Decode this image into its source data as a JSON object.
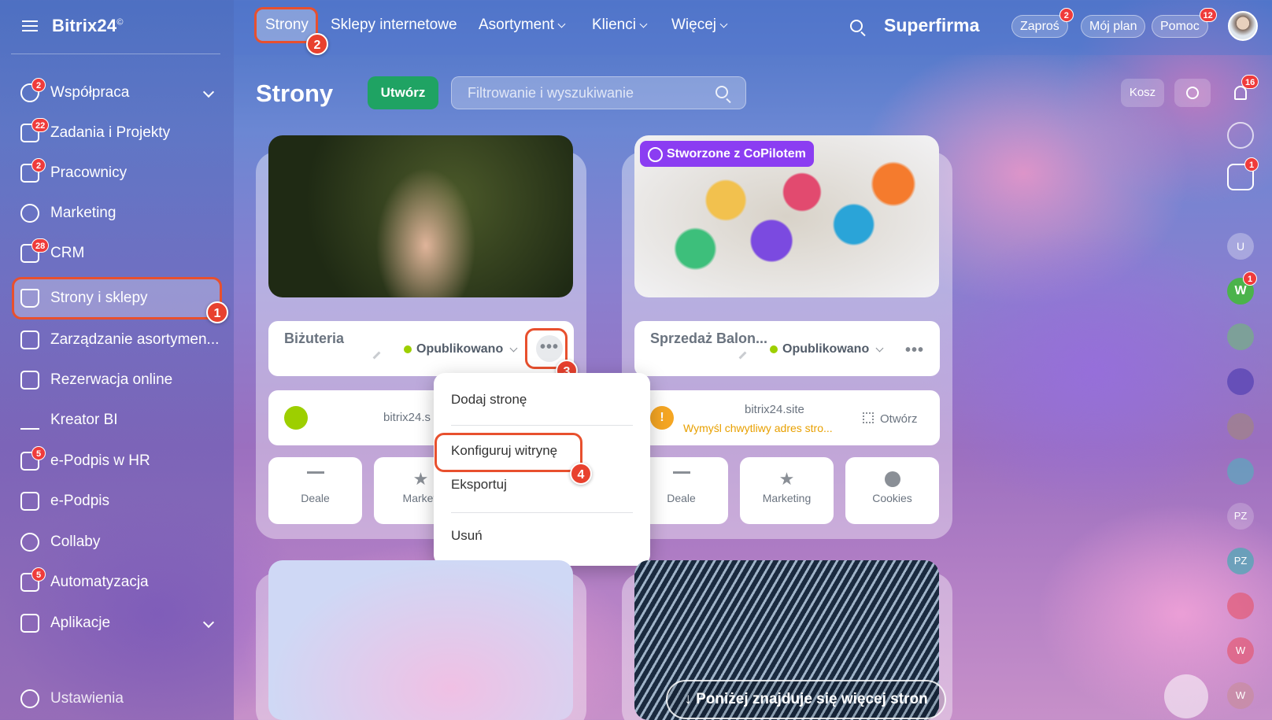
{
  "brand": {
    "name": "Bitrix24",
    "mark": "©"
  },
  "sidebar": {
    "items": [
      {
        "label": "Współpraca",
        "badge": "2"
      },
      {
        "label": "Zadania i Projekty",
        "badge": "22"
      },
      {
        "label": "Pracownicy",
        "badge": "2"
      },
      {
        "label": "Marketing",
        "badge": ""
      },
      {
        "label": "CRM",
        "badge": "28"
      },
      {
        "label": "Strony i sklepy",
        "badge": ""
      },
      {
        "label": "Zarządzanie asortymen...",
        "badge": ""
      },
      {
        "label": "Rezerwacja online",
        "badge": ""
      },
      {
        "label": "Kreator BI",
        "badge": ""
      },
      {
        "label": "e-Podpis w HR",
        "badge": "5"
      },
      {
        "label": "e-Podpis",
        "badge": ""
      },
      {
        "label": "Collaby",
        "badge": ""
      },
      {
        "label": "Automatyzacja",
        "badge": "5"
      },
      {
        "label": "Aplikacje",
        "badge": ""
      }
    ],
    "settings": "Ustawienia"
  },
  "topnav": {
    "items": [
      "Strony",
      "Sklepy internetowe",
      "Asortyment",
      "Klienci",
      "Więcej"
    ]
  },
  "header": {
    "company": "Superfirma",
    "invite": "Zaproś",
    "invite_badge": "2",
    "plan": "Mój plan",
    "help": "Pomoc",
    "help_badge": "12"
  },
  "page": {
    "title": "Strony",
    "create": "Utwórz",
    "search_placeholder": "Filtrowanie i wyszukiwanie",
    "trash": "Kosz",
    "notif_badge": "16"
  },
  "cards": [
    {
      "title": "Biżuteria",
      "status": "Opublikowano",
      "url": "bitrix24.s",
      "tiles": [
        "Deale",
        "Marketi"
      ]
    },
    {
      "title": "Sprzedaż Balon...",
      "status": "Opublikowano",
      "url": "bitrix24.site",
      "url_hint": "Wymyśl chwytliwy adres stro...",
      "open": "Otwórz",
      "tag": "Stworzone z CoPilotem",
      "tiles": [
        "Deale",
        "Marketing",
        "Cookies"
      ]
    }
  ],
  "dropdown": {
    "items": [
      "Dodaj stronę",
      "Konfiguruj witrynę",
      "Eksportuj",
      "Usuń"
    ]
  },
  "markers": [
    "1",
    "2",
    "3",
    "4"
  ],
  "more_pages": "Poniżej znajduje się więcej stron",
  "rail": {
    "badge_chat": "1",
    "w_badge": "1",
    "w_initial": "W",
    "pz1": "PZ",
    "pz2": "PZ",
    "w2": "W",
    "w3": "W",
    "u": "U"
  },
  "colors": {
    "accent_green": "#1fa363",
    "marker_red": "#e8412e",
    "copilot_purple": "#8b3df2"
  }
}
